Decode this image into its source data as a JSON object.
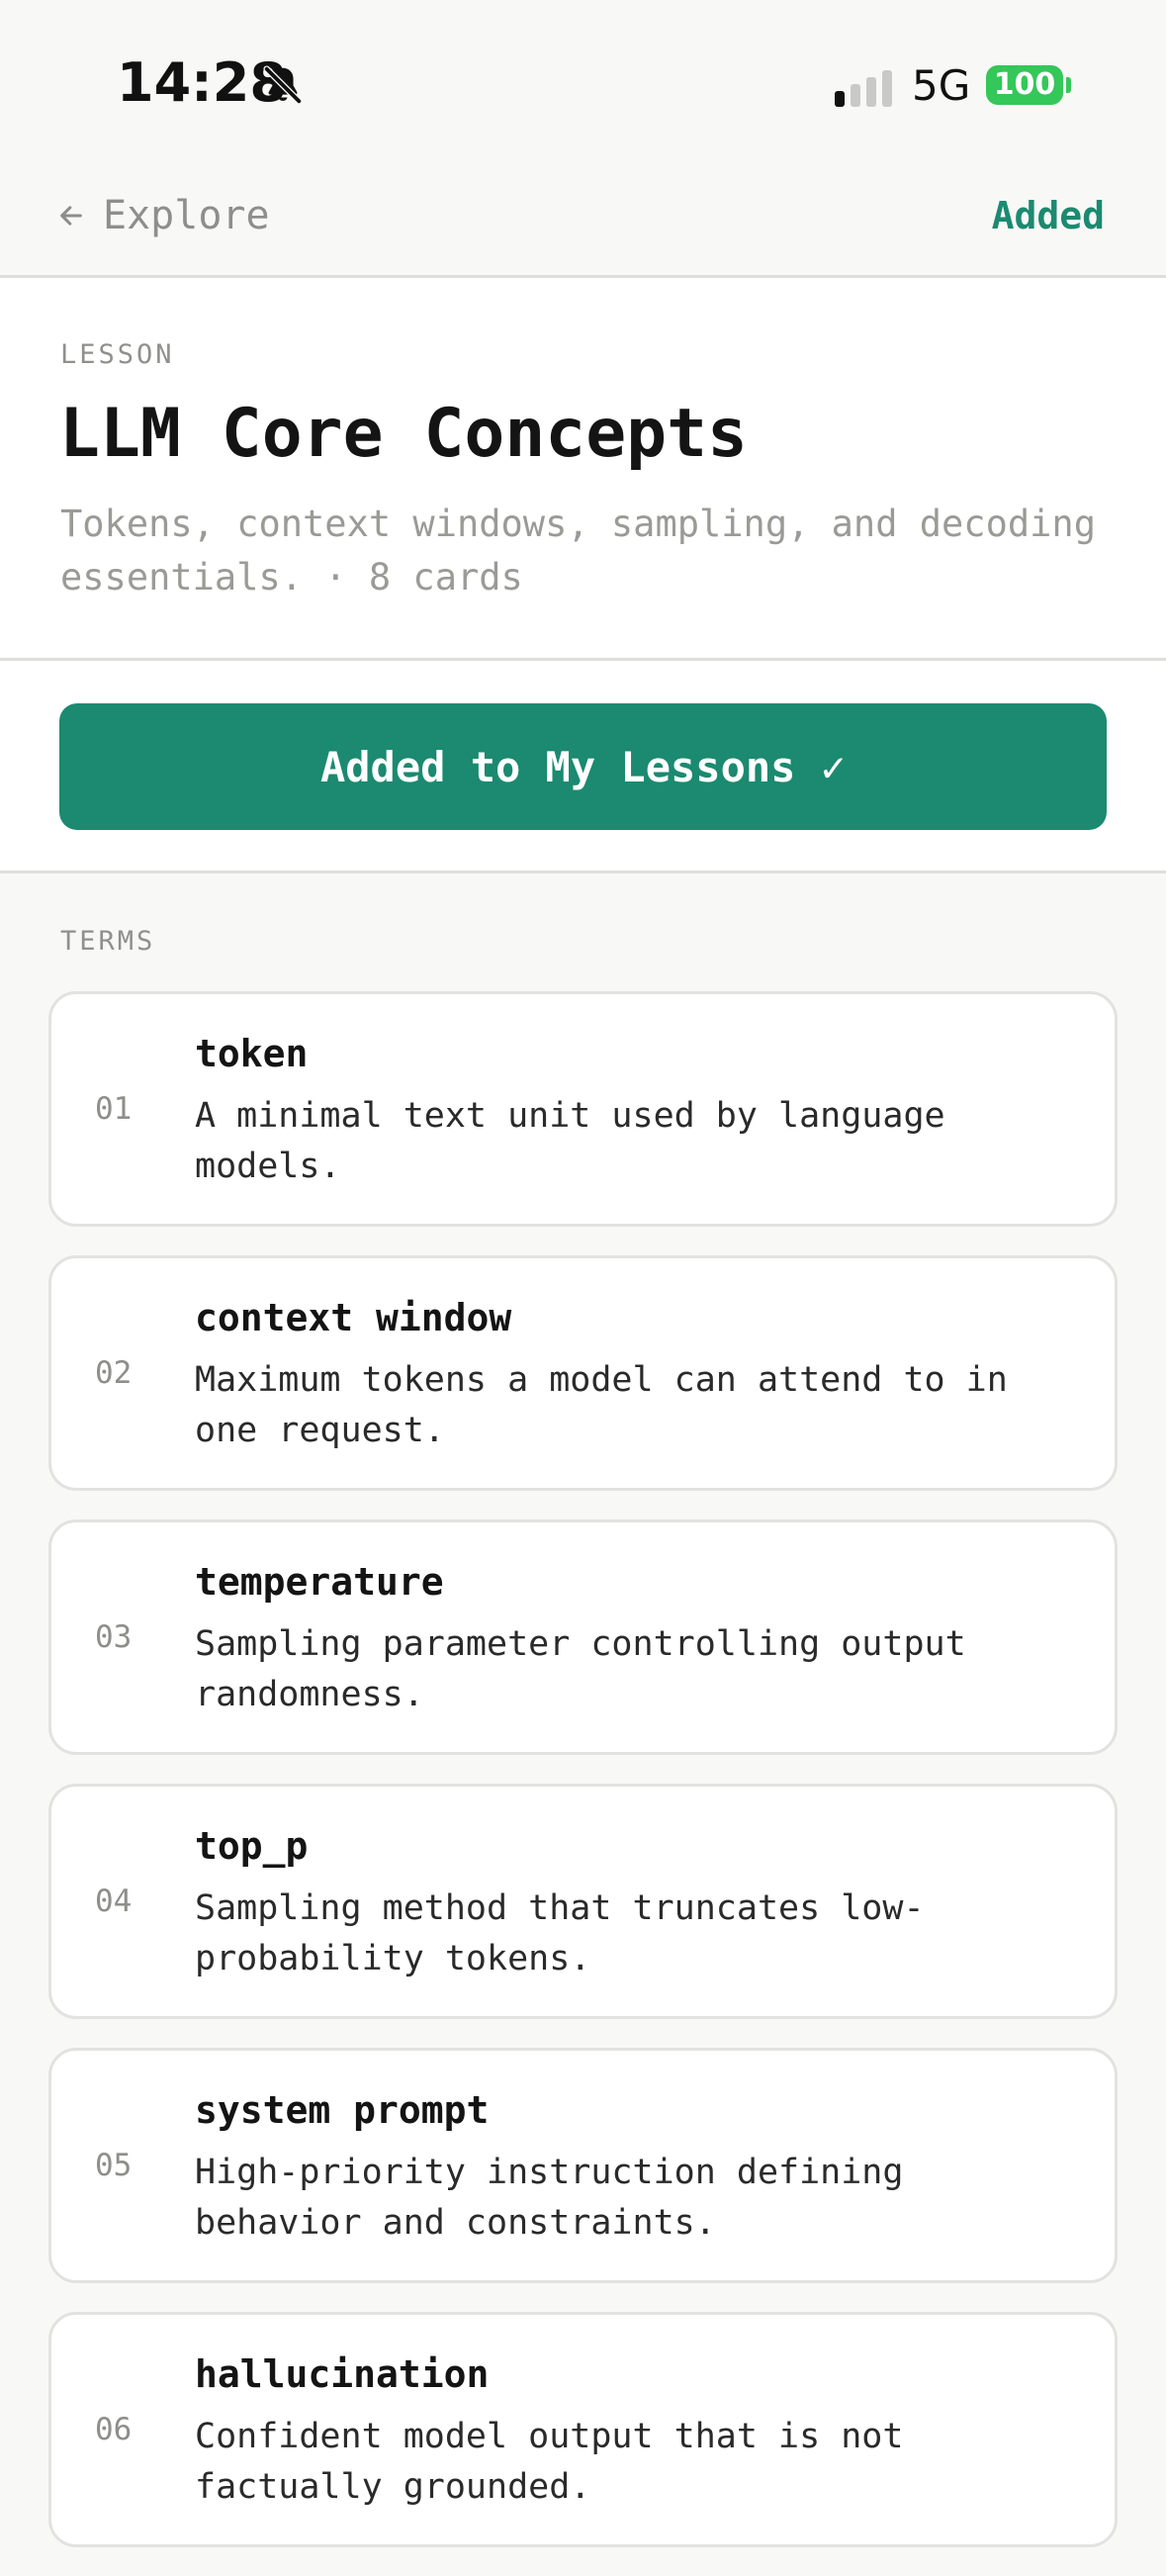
{
  "status_bar": {
    "time": "14:28",
    "network": "5G",
    "battery": "100"
  },
  "nav": {
    "back_label": "Explore",
    "status_label": "Added"
  },
  "lesson": {
    "eyebrow": "LESSON",
    "title": "LLM Core Concepts",
    "description": "Tokens, context windows, sampling, and decoding essentials. · 8 cards"
  },
  "action": {
    "button_label": "Added to My Lessons ✓"
  },
  "terms": {
    "label": "TERMS",
    "items": [
      {
        "index": "01",
        "term": "token",
        "definition": "A minimal text unit used by language models."
      },
      {
        "index": "02",
        "term": "context window",
        "definition": "Maximum tokens a model can attend to in one request."
      },
      {
        "index": "03",
        "term": "temperature",
        "definition": "Sampling parameter controlling output randomness."
      },
      {
        "index": "04",
        "term": "top_p",
        "definition": "Sampling method that truncates low-probability tokens."
      },
      {
        "index": "05",
        "term": "system prompt",
        "definition": "High-priority instruction defining behavior and constraints."
      },
      {
        "index": "06",
        "term": "hallucination",
        "definition": "Confident model output that is not factually grounded."
      }
    ]
  },
  "colors": {
    "accent": "#1b8a70",
    "background": "#f8f8f6",
    "battery": "#34c759"
  },
  "icons": {
    "back": "arrow-left-icon",
    "bell": "bell-slash-icon",
    "signal": "cellular-signal-icon",
    "battery": "battery-icon"
  }
}
